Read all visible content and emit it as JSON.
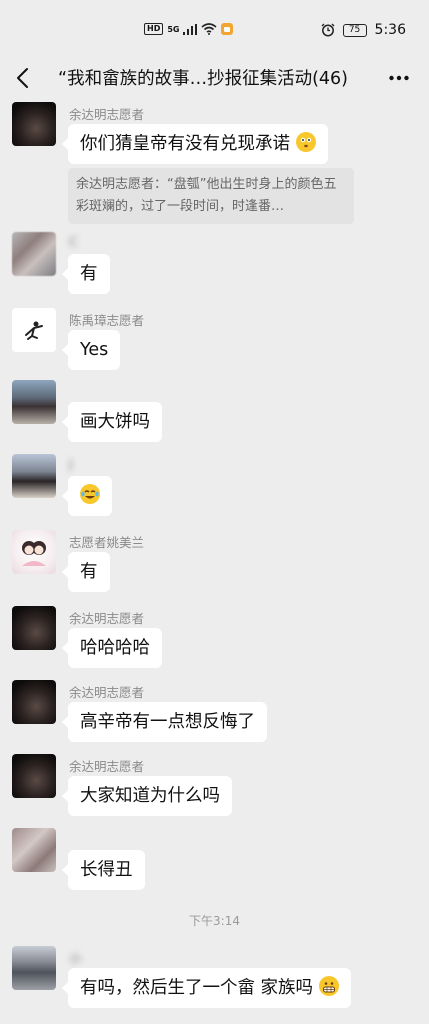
{
  "status_bar": {
    "hd": "HD",
    "network": "5G",
    "battery": "75",
    "time": "5:36"
  },
  "header": {
    "title": "“我和畲族的故事…抄报征集活动(46)"
  },
  "messages": [
    {
      "sender": "余达明志愿者",
      "text": "你们猜皇帝有没有兑现承诺",
      "emoji": "flushed",
      "quote": "余达明志愿者：“盘瓠”他出生时身上的颜色五彩斑斓的，过了一段时间，时逢番…"
    },
    {
      "sender": "C",
      "text": "有"
    },
    {
      "sender": "陈禹璋志愿者",
      "text": "Yes"
    },
    {
      "sender": "",
      "text": "画大饼吗"
    },
    {
      "sender": "J",
      "text": "",
      "emoji": "laughing-tears"
    },
    {
      "sender": "志愿者姚美兰",
      "text": "有"
    },
    {
      "sender": "余达明志愿者",
      "text": "哈哈哈哈"
    },
    {
      "sender": "余达明志愿者",
      "text": "高辛帝有一点想反悔了"
    },
    {
      "sender": "余达明志愿者",
      "text": "大家知道为什么吗"
    },
    {
      "sender": "",
      "text": "长得丑"
    },
    {
      "sender": "小",
      "text": "有吗，然后生了一个畲 家族吗",
      "emoji": "grin"
    }
  ],
  "time_divider": "下午3:14",
  "colors": {
    "background": "#ededed",
    "bubble": "#ffffff",
    "sender": "#8a8a8a"
  }
}
